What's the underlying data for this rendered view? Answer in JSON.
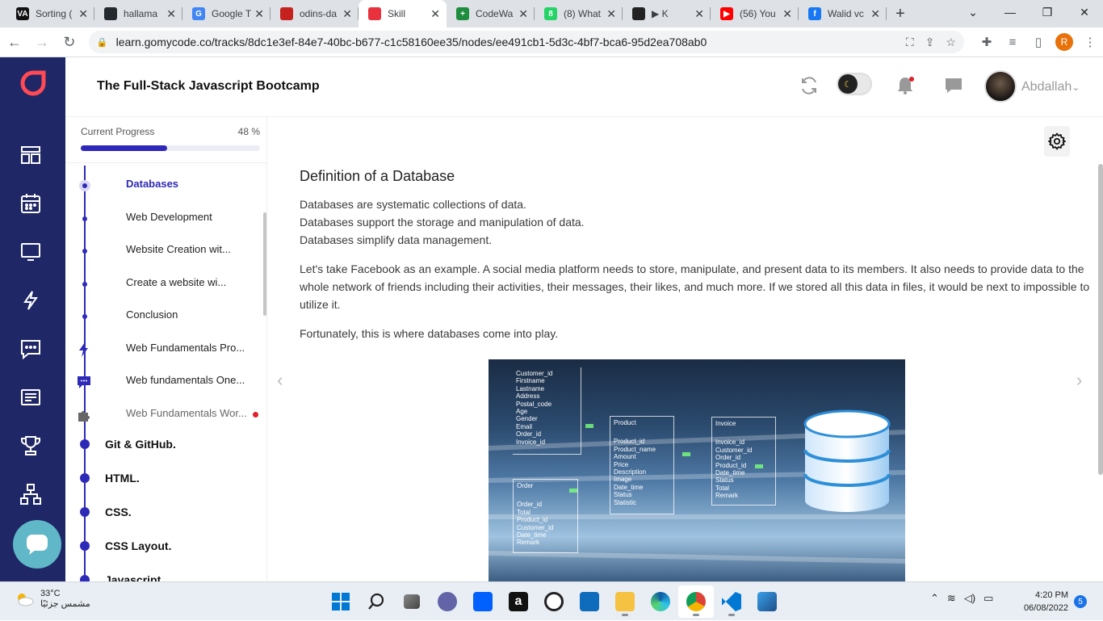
{
  "browser": {
    "tabs": [
      {
        "title": "Sorting (",
        "favicon_color": "#111111",
        "favicon_text": "VA"
      },
      {
        "title": "hallama",
        "favicon_color": "#24292f",
        "favicon_text": ""
      },
      {
        "title": "Google T",
        "favicon_color": "#4285f4",
        "favicon_text": "G"
      },
      {
        "title": "odins-da",
        "favicon_color": "#c5221f",
        "favicon_text": ""
      },
      {
        "title": "Skill",
        "favicon_color": "#e8333f",
        "favicon_text": ""
      },
      {
        "title": "CodeWa",
        "favicon_color": "#1e8e3e",
        "favicon_text": "+"
      },
      {
        "title": "(8) What",
        "favicon_color": "#25d366",
        "favicon_text": "8"
      },
      {
        "title": "▶ K",
        "favicon_color": "#222222",
        "favicon_text": ""
      },
      {
        "title": "(56) You",
        "favicon_color": "#ff0000",
        "favicon_text": "▶"
      },
      {
        "title": "Walid vc",
        "favicon_color": "#1877f2",
        "favicon_text": "f"
      }
    ],
    "active_tab_index": 4,
    "url": "learn.gomycode.co/tracks/8dc1e3ef-84e7-40bc-b677-c1c58160ee35/nodes/ee491cb1-5d3c-4bf7-bca6-95d2ea708ab0",
    "profile_initial": "R"
  },
  "app": {
    "course_title": "The Full-Stack Javascript Bootcamp",
    "user_name": "Abdallah",
    "accent_color": "#2d28b9",
    "nav_color": "#1f2766"
  },
  "progress": {
    "label": "Current Progress",
    "percent_text": "48 %",
    "fraction": 0.48
  },
  "lessons": [
    {
      "label": "Databases",
      "active": true
    },
    {
      "label": "Web Development"
    },
    {
      "label": "Website Creation wit..."
    },
    {
      "label": "Create a website wi..."
    },
    {
      "label": "Conclusion"
    },
    {
      "label": "Web Fundamentals Pro..."
    },
    {
      "label": "Web fundamentals One..."
    },
    {
      "label": "Web Fundamentals Wor..."
    }
  ],
  "chapters": [
    "Git & GitHub.",
    "HTML.",
    "CSS.",
    "CSS Layout.",
    "Javascript"
  ],
  "article": {
    "heading": "Definition of a Database",
    "intro_lines": [
      "Databases are systematic collections of data.",
      "Databases support the storage and manipulation of data.",
      "Databases simplify data management."
    ],
    "paragraph": "Let's take Facebook as an example. A social media platform needs to store, manipulate, and present data to its members. It also needs to provide data to the whole network of friends including their activities, their messages, their likes, and much more. If we stored all this data in files, it would be next to impossible to utilize it.",
    "paragraph2": "Fortunately, this is where databases come into play."
  },
  "diagram": {
    "customer_fields": [
      "Customer_id",
      "Firstname",
      "Lastname",
      "Address",
      "Postal_code",
      "Age",
      "Gender",
      "Email",
      "Order_id",
      "Invoice_id"
    ],
    "product_title": "Product",
    "product_fields": [
      "Product_id",
      "Product_name",
      "Amount",
      "Price",
      "Description",
      "Image",
      "Date_time",
      "Status",
      "Statistic"
    ],
    "invoice_title": "Invoice",
    "invoice_fields": [
      "Invoice_id",
      "Customer_id",
      "Order_id",
      "Product_id",
      "Date_time",
      "Status",
      "Total",
      "Remark"
    ],
    "order_title": "Order",
    "order_fields": [
      "Order_id",
      "Total",
      "Product_id",
      "Customer_id",
      "Date_time",
      "Remark"
    ]
  },
  "taskbar": {
    "temperature": "33°C",
    "weather_desc": "مشمس جزئيًا",
    "time": "4:20 PM",
    "date": "06/08/2022",
    "notifications": "5"
  }
}
